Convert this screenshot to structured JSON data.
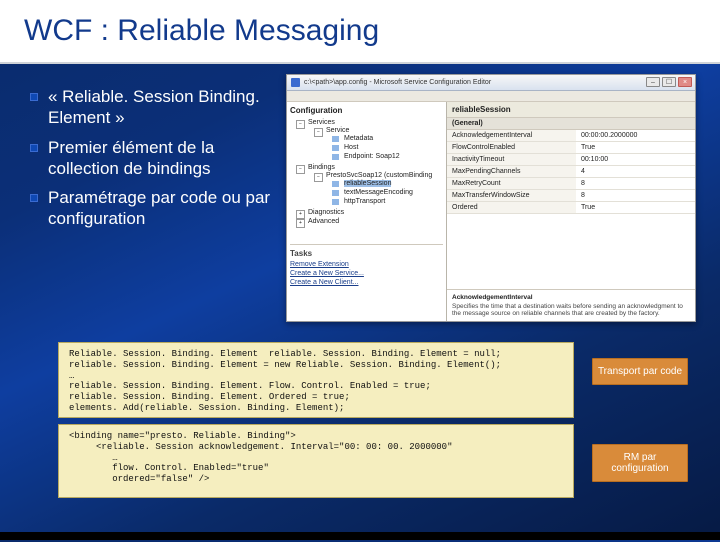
{
  "title": "WCF : Reliable Messaging",
  "bullets": [
    "« Reliable. Session Binding. Element »",
    "Premier élément de la collection de bindings",
    "Paramétrage par code ou par configuration"
  ],
  "shot": {
    "window_title": "c:\\<path>\\app.config - Microsoft Service Configuration Editor",
    "tree_header": "Configuration",
    "tree": {
      "root": "Services",
      "svc": "Service",
      "meta": "Metadata",
      "host": "Host",
      "ep": "Endpoint: Soap12",
      "bindings": "Bindings",
      "binding": "PrestoSvcSoap12 (customBinding",
      "rel": "reliableSession",
      "enc": "textMessageEncoding",
      "http": "httpTransport",
      "diag": "Diagnostics",
      "adv": "Advanced"
    },
    "tasks_header": "Tasks",
    "tasks": {
      "remove": "Remove Extension",
      "newsvc": "Create a New Service...",
      "newcli": "Create a New Client..."
    },
    "prop_header": "reliableSession",
    "section": "(General)",
    "props": [
      {
        "k": "AcknowledgementInterval",
        "v": "00:00:00.2000000"
      },
      {
        "k": "FlowControlEnabled",
        "v": "True"
      },
      {
        "k": "InactivityTimeout",
        "v": "00:10:00"
      },
      {
        "k": "MaxPendingChannels",
        "v": "4"
      },
      {
        "k": "MaxRetryCount",
        "v": "8"
      },
      {
        "k": "MaxTransferWindowSize",
        "v": "8"
      },
      {
        "k": "Ordered",
        "v": "True"
      }
    ],
    "desc_title": "AcknowledgementInterval",
    "desc_body": "Specifies the time that a destination waits before sending an acknowledgment to the message source on reliable channels that are created by the factory."
  },
  "code1": "Reliable. Session. Binding. Element  reliable. Session. Binding. Element = null;\nreliable. Session. Binding. Element = new Reliable. Session. Binding. Element();\n…\nreliable. Session. Binding. Element. Flow. Control. Enabled = true;\nreliable. Session. Binding. Element. Ordered = true;\nelements. Add(reliable. Session. Binding. Element);",
  "code2": "<binding name=\"presto. Reliable. Binding\">\n     <reliable. Session acknowledgement. Interval=\"00: 00: 00. 2000000\"\n        …\n        flow. Control. Enabled=\"true\"\n        ordered=\"false\" />",
  "tag1": "Transport par code",
  "tag2": "RM par configuration"
}
